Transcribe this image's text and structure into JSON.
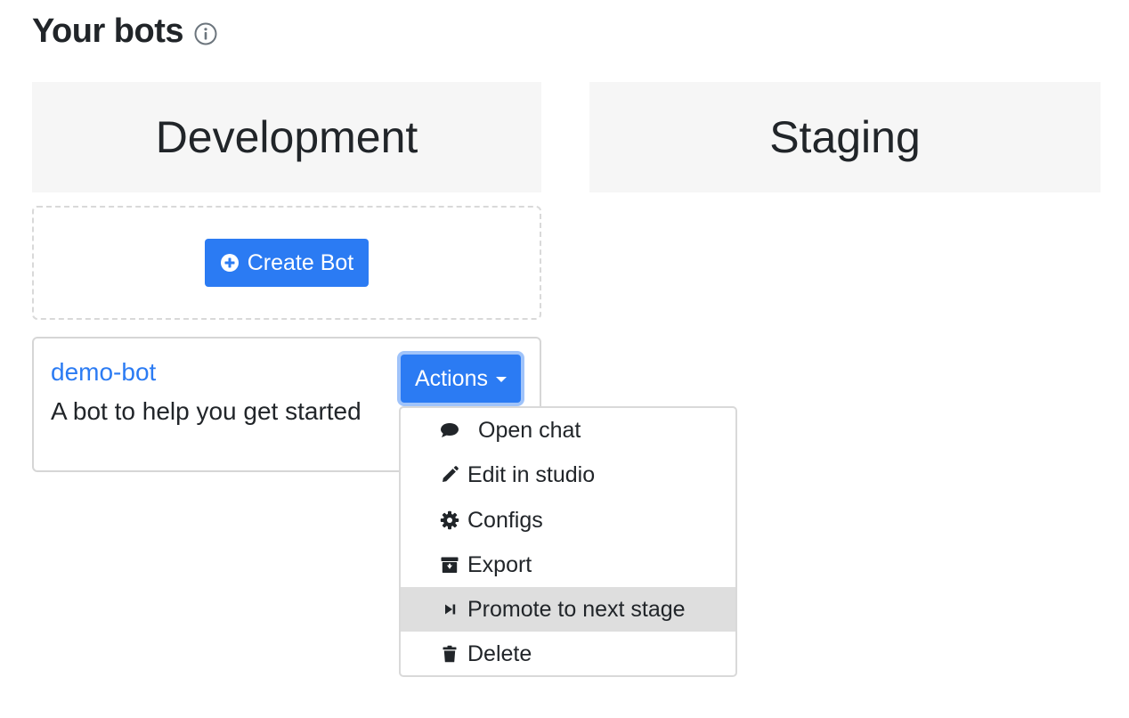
{
  "header": {
    "title": "Your bots",
    "info_icon": "info-circle-icon"
  },
  "stages": [
    {
      "title": "Development"
    },
    {
      "title": "Staging"
    }
  ],
  "create": {
    "label": "Create Bot",
    "icon": "plus-circle-icon"
  },
  "bot": {
    "name": "demo-bot",
    "description": "A bot to help you get started",
    "actions_label": "Actions"
  },
  "menu": {
    "items": [
      {
        "label": "Open chat",
        "icon": "chat-bubble-icon"
      },
      {
        "label": "Edit in studio",
        "icon": "pencil-icon"
      },
      {
        "label": "Configs",
        "icon": "gear-icon"
      },
      {
        "label": "Export",
        "icon": "archive-icon"
      },
      {
        "label": "Promote to next stage",
        "icon": "skip-forward-icon",
        "active": true
      },
      {
        "label": "Delete",
        "icon": "trash-icon"
      }
    ]
  },
  "colors": {
    "primary": "#2b7bf3",
    "stage_header_bg": "#f6f6f6",
    "menu_active_bg": "#dedede",
    "text": "#212529"
  }
}
